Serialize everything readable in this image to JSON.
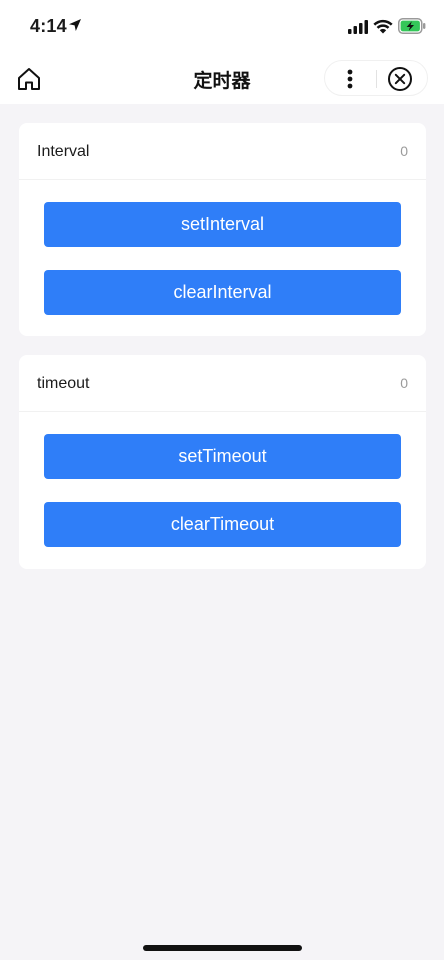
{
  "status_bar": {
    "time": "4:14",
    "icons": [
      "location-arrow-icon",
      "cellular-signal-icon",
      "wifi-icon",
      "battery-charging-icon"
    ],
    "battery_color": "#34c759"
  },
  "nav_bar": {
    "title": "定时器",
    "icons": [
      "home-icon",
      "more-vertical-icon",
      "close-circle-icon"
    ]
  },
  "sections": [
    {
      "title": "Interval",
      "count": "0",
      "buttons": [
        "setInterval",
        "clearInterval"
      ]
    },
    {
      "title": "timeout",
      "count": "0",
      "buttons": [
        "setTimeout",
        "clearTimeout"
      ]
    }
  ],
  "colors": {
    "primary_button": "#2f7ef8",
    "page_background": "#f5f4f7",
    "card_background": "#ffffff"
  }
}
